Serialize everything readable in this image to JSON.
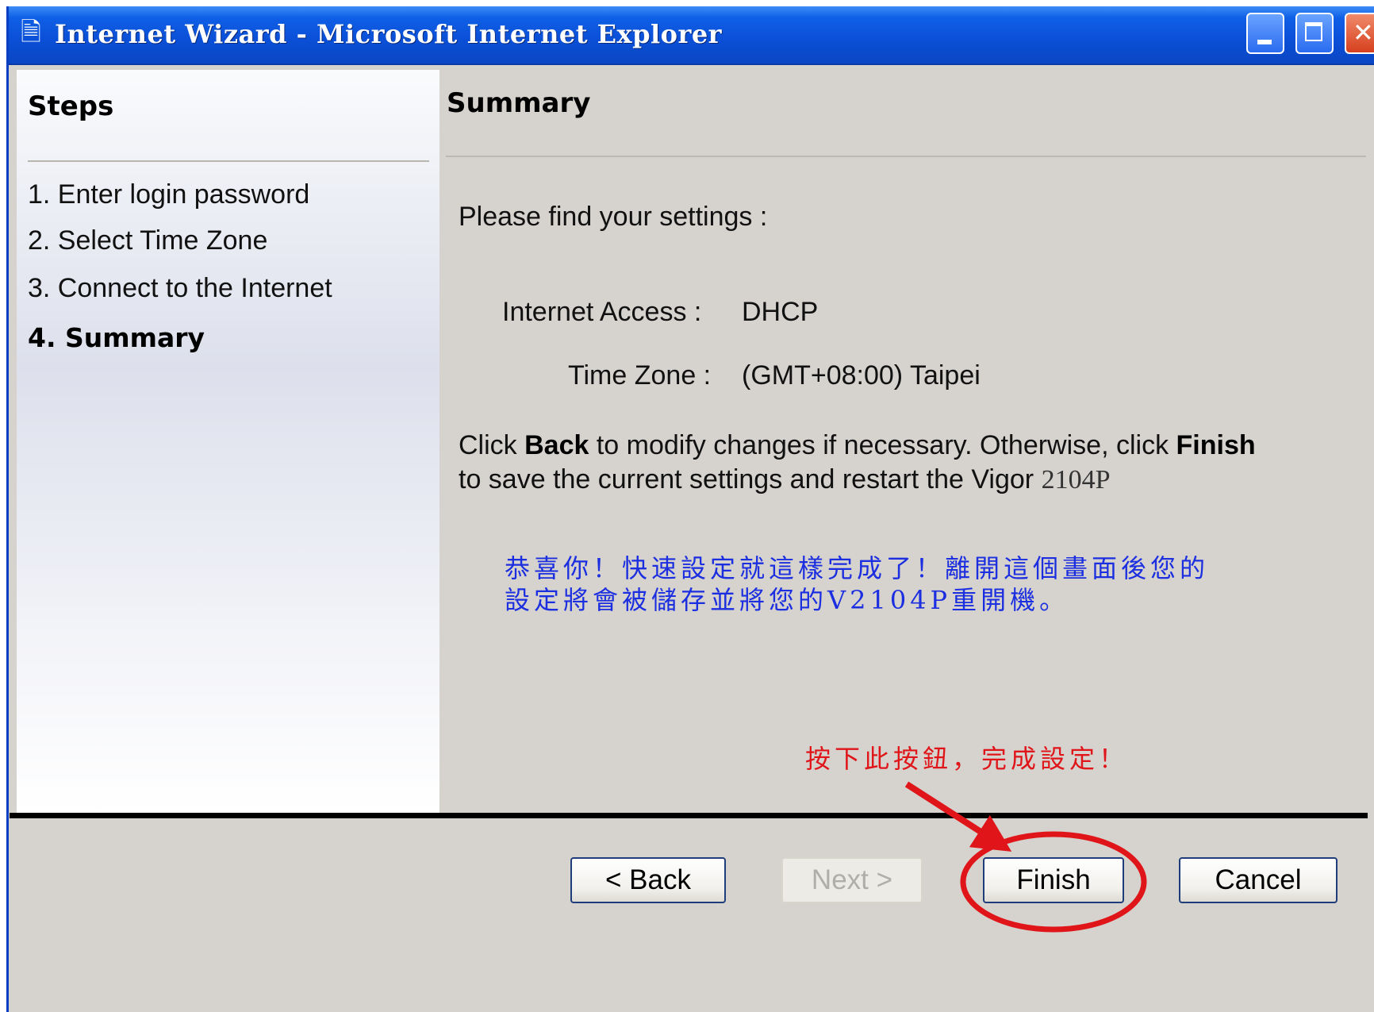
{
  "window": {
    "title": "Internet Wizard - Microsoft Internet Explorer",
    "title_icon": "ie-page-icon",
    "controls": [
      "minimize-icon",
      "maximize-icon",
      "close-icon"
    ]
  },
  "steps": {
    "heading": "Steps",
    "items": [
      {
        "label": "1. Enter login password",
        "current": false
      },
      {
        "label": "2. Select Time Zone",
        "current": false
      },
      {
        "label": "3. Connect to the Internet",
        "current": false
      },
      {
        "label": "4. Summary",
        "current": true
      }
    ]
  },
  "summary": {
    "heading": "Summary",
    "intro": "Please find your settings :",
    "internet_access_label": "Internet Access :",
    "internet_access_value": "DHCP",
    "time_zone_label": "Time Zone :",
    "time_zone_value": "(GMT+08:00) Taipei",
    "instruction_part1": "Click",
    "instruction_back": "Back",
    "instruction_part2": "to modify changes if necessary. Otherwise, click",
    "instruction_finish": "Finish",
    "instruction_part3": "to save the current settings and restart the Vigor",
    "instruction_model": "2104P",
    "note_line1": "恭喜你！快速設定就這樣完成了！離開這個畫面後您的",
    "note_line2": "設定將會被儲存並將您的V2104P重開機。",
    "note_color": "#1b2ee0"
  },
  "annotation": {
    "text": "按下此按鈕，完成設定！",
    "color": "#e0151a"
  },
  "buttons": {
    "back": "< Back",
    "next": "Next >",
    "next_enabled": false,
    "finish": "Finish",
    "cancel": "Cancel"
  },
  "colors": {
    "titlebar": "#0a4fd6",
    "dialog_background": "#d6d3ce",
    "button_border": "#1f3d7a"
  }
}
